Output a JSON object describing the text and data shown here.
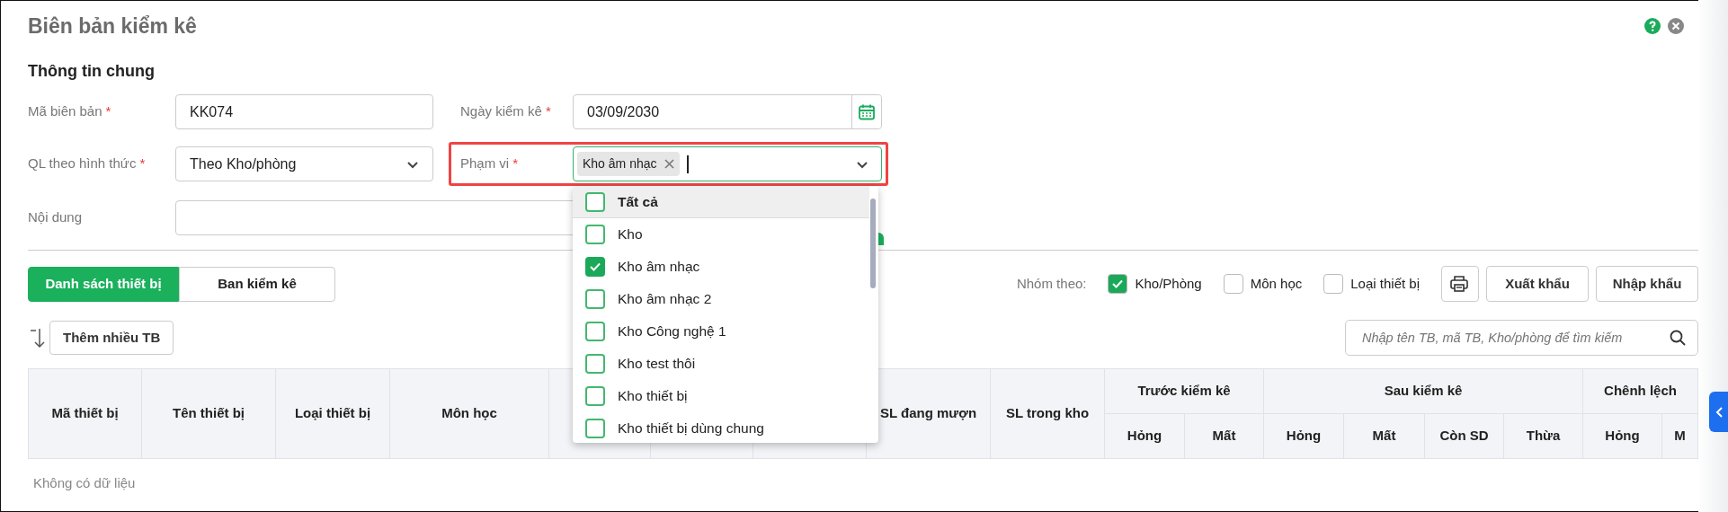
{
  "dialog": {
    "title": "Biên bản kiểm kê"
  },
  "section_title": "Thông tin chung",
  "fields": {
    "code": {
      "label": "Mã biên bản",
      "required_mark": "*",
      "value": "KK074"
    },
    "date": {
      "label": "Ngày kiểm kê",
      "required_mark": "*",
      "value": "03/09/2030"
    },
    "management": {
      "label": "QL theo hình thức",
      "required_mark": "*",
      "value": "Theo Kho/phòng"
    },
    "scope": {
      "label": "Phạm vi",
      "required_mark": "*",
      "tags": [
        {
          "label": "Kho âm nhạc"
        }
      ],
      "highlighted": true
    },
    "content": {
      "label": "Nội dung"
    }
  },
  "scope_dropdown": {
    "options": [
      {
        "label": "Tất cả",
        "kind": "all",
        "checked": false,
        "highlighted": true
      },
      {
        "label": "Kho",
        "kind": "option",
        "checked": false,
        "highlighted": false
      },
      {
        "label": "Kho âm nhạc",
        "kind": "option",
        "checked": true,
        "highlighted": false
      },
      {
        "label": "Kho âm nhạc 2",
        "kind": "option",
        "checked": false,
        "highlighted": false
      },
      {
        "label": "Kho Công nghệ 1",
        "kind": "option",
        "checked": false,
        "highlighted": false
      },
      {
        "label": "Kho test thôi",
        "kind": "option",
        "checked": false,
        "highlighted": false
      },
      {
        "label": "Kho thiết bị",
        "kind": "option",
        "checked": false,
        "highlighted": false
      },
      {
        "label": "Kho thiết bị dùng chung",
        "kind": "option",
        "checked": false,
        "highlighted": false
      }
    ]
  },
  "tabs": [
    {
      "label": "Danh sách thiết bị",
      "selected": true
    },
    {
      "label": "Ban kiểm kê",
      "selected": false
    }
  ],
  "group_by": {
    "label": "Nhóm theo:",
    "options": [
      {
        "label": "Kho/Phòng",
        "checked": true
      },
      {
        "label": "Môn học",
        "checked": false
      },
      {
        "label": "Loại thiết bị",
        "checked": false
      }
    ]
  },
  "buttons": [
    "Xuất khẩu",
    "Nhập khẩu"
  ],
  "add_button": "Thêm nhiều TB",
  "search": {
    "placeholder": "Nhập tên TB, mã TB, Kho/phòng để tìm kiếm"
  },
  "table": {
    "columns": [
      {
        "label": "Mã thiết bị"
      },
      {
        "label": "Tên thiết bị"
      },
      {
        "label": "Loại thiết bị"
      },
      {
        "label": "Môn học"
      },
      {},
      {},
      {},
      {
        "label": "SL đang mượn"
      },
      {
        "label": "SL trong kho"
      },
      {
        "label": "Trước kiểm kê",
        "children": [
          {
            "label": "Hỏng"
          },
          {
            "label": "Mất"
          }
        ]
      },
      {
        "label": "Sau kiểm kê",
        "children": [
          {
            "label": "Hỏng"
          },
          {
            "label": "Mất"
          },
          {
            "label": "Còn SD"
          },
          {
            "label": "Thừa"
          }
        ]
      },
      {
        "label": "Chênh lệch",
        "children": [
          {
            "label": "Hỏng"
          },
          {
            "label": "M"
          }
        ]
      }
    ],
    "empty_text": "Không có dữ liệu"
  }
}
